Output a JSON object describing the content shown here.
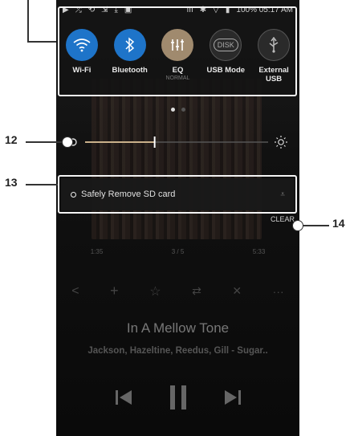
{
  "status": {
    "battery": "100% 05:17 AM",
    "left_icons": [
      "play-icon",
      "shuffle-icon",
      "hires-icon",
      "arrows-icon",
      "download-icon",
      "image-icon"
    ]
  },
  "quick_settings": [
    {
      "label": "Wi-Fi",
      "icon": "wifi-icon",
      "color": "#1e74c9",
      "active": true
    },
    {
      "label": "Bluetooth",
      "icon": "bluetooth-icon",
      "color": "#1e74c9",
      "active": true
    },
    {
      "label": "EQ",
      "sub": "NORMAL",
      "icon": "eq-icon",
      "color": "#a08a6e",
      "active": true
    },
    {
      "label": "USB Mode",
      "icon": "disk-icon",
      "color": "#2a2a2a",
      "active": false
    },
    {
      "label": "External USB",
      "icon": "usb-icon",
      "color": "#2a2a2a",
      "active": false
    }
  ],
  "disk_text": "DISK",
  "notification": {
    "text": "Safely Remove SD card"
  },
  "clear_label": "CLEAR",
  "player": {
    "time_elapsed": "1:35",
    "track_pos": "3 / 5",
    "time_total": "5:33",
    "title": "In A Mellow Tone",
    "artist": "Jackson, Hazeltine, Reedus, Gill - Sugar.."
  },
  "callouts": {
    "c12": "12",
    "c13": "13",
    "c14": "14"
  },
  "colors": {
    "accent": "#1e74c9",
    "eq": "#a08a6e",
    "slider": "#c9b08a"
  },
  "brightness_level": 0.38
}
